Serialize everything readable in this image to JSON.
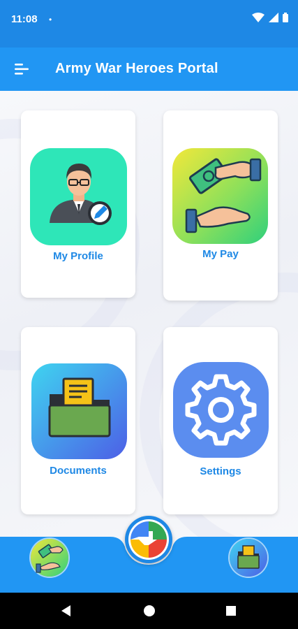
{
  "status_bar": {
    "time": "11:08",
    "dot": "•"
  },
  "app_bar": {
    "title": "Army War Heroes Portal"
  },
  "cards": {
    "my_profile": "My Profile",
    "my_pay": "My Pay",
    "documents": "Documents",
    "settings": "Settings"
  },
  "colors": {
    "status_bar": "#1e88e5",
    "app_bar": "#2196f3",
    "label": "#1e88e5",
    "profile_tile": "#2ee6b8",
    "pay_tile_start": "#f2e83a",
    "pay_tile_end": "#2fd07c",
    "documents_tile_start": "#3fd4f0",
    "documents_tile_end": "#4d5fe6",
    "settings_tile": "#5b8def"
  },
  "icons": {
    "menu": "menu-icon",
    "wifi": "wifi-icon",
    "signal": "signal-icon",
    "battery": "battery-icon",
    "profile": "user-edit-icon",
    "pay": "money-hands-icon",
    "documents": "folder-icon",
    "settings": "gear-icon",
    "bottom_left": "money-hands-icon",
    "bottom_center": "app-grid-icon",
    "bottom_right": "folder-icon",
    "back": "back-icon",
    "home": "home-icon",
    "recents": "recents-icon"
  }
}
